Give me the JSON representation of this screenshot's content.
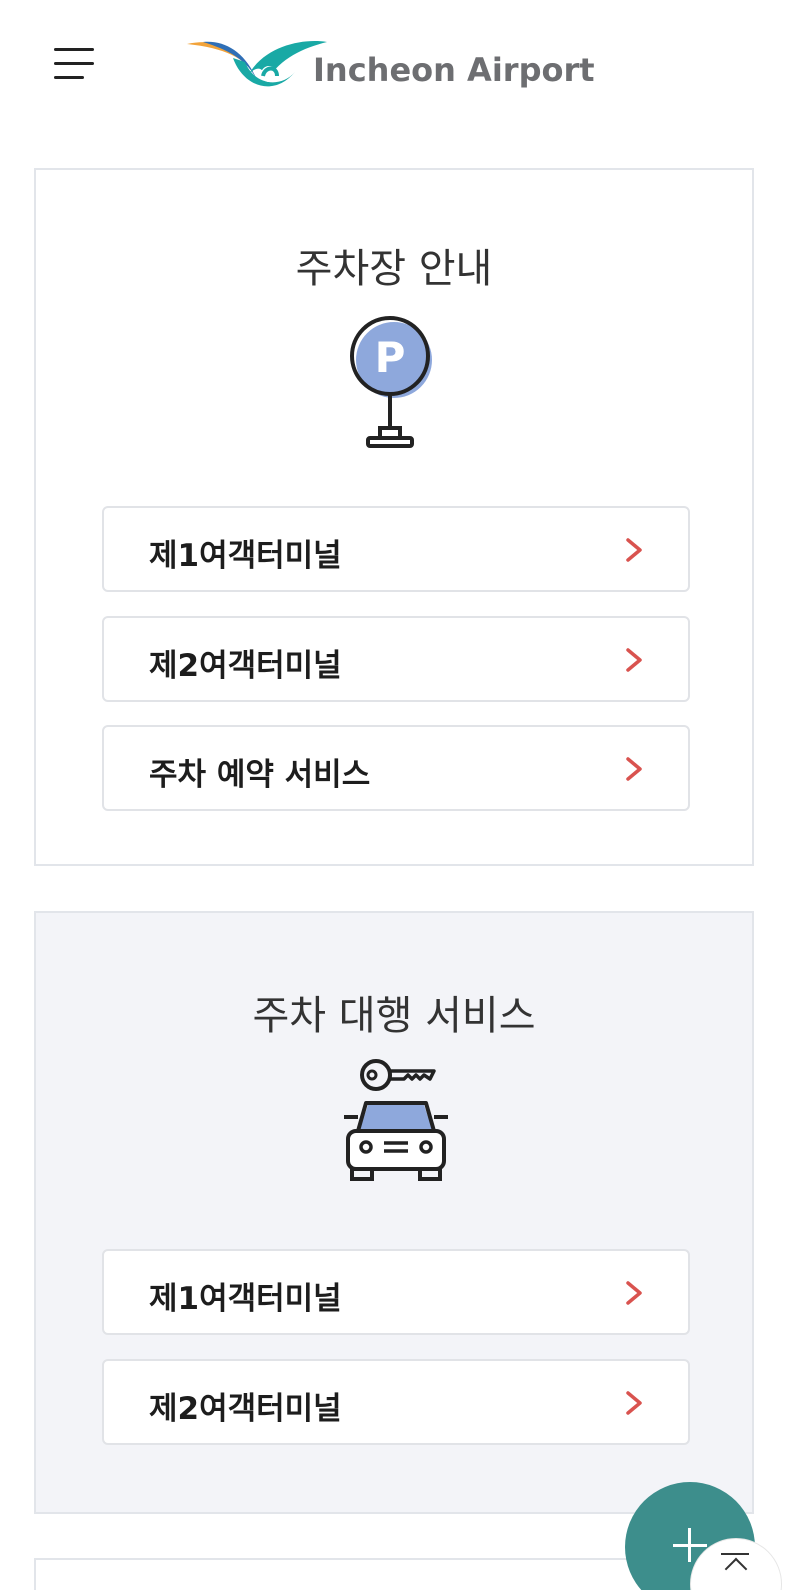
{
  "header": {
    "logo_text": "Incheon Airport"
  },
  "sections": [
    {
      "title": "주차장 안내",
      "icon": "parking-sign-icon",
      "items": [
        {
          "label": "제1여객터미널"
        },
        {
          "label": "제2여객터미널"
        },
        {
          "label": "주차 예약 서비스"
        }
      ]
    },
    {
      "title": "주차 대행 서비스",
      "icon": "car-key-icon",
      "items": [
        {
          "label": "제1여객터미널"
        },
        {
          "label": "제2여객터미널"
        }
      ]
    }
  ],
  "colors": {
    "accent_arrow": "#d9534f",
    "fab": "#3d8e8c",
    "section_alt_bg": "#f3f4f8",
    "illustration_blue": "#8ea8dc"
  },
  "icons": {
    "menu": "hamburger-menu-icon",
    "arrow": "chevron-right-icon",
    "fab": "plus-icon",
    "top": "scroll-top-icon"
  }
}
